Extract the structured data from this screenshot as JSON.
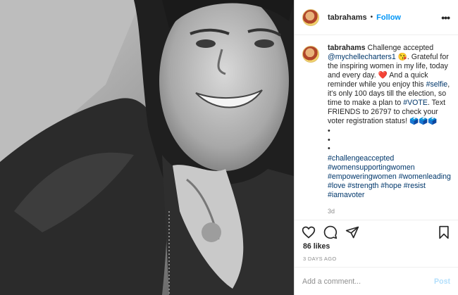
{
  "header": {
    "username": "tabrahams",
    "separator": "•",
    "follow_label": "Follow",
    "more_label": "•••"
  },
  "caption": {
    "username": "tabrahams",
    "text_1": "Challenge accepted",
    "mention": "@mychellecharters1",
    "emoji_1": "😘",
    "text_2": ". Grateful for the inspiring women in my life, today and every day.",
    "emoji_2": "❤️",
    "text_3": " And a quick reminder while you enjoy this",
    "tag_selfie": "#selfie",
    "text_4": ", it's only 100 days till the election, so time to make a plan to",
    "tag_vote": "#VOTE",
    "text_5": ". Text FRIENDS to 26797 to check your voter registration status!",
    "emoji_3": "🗳️🗳️🗳️",
    "bullets": [
      "•",
      "•",
      "•"
    ],
    "hashtags": "#challengeaccepted #womensupportingwomen #empoweringwomen #womenleading #love #strength #hope #resist #iamavoter",
    "time": "3d"
  },
  "actions": {
    "like_icon": "heart-icon",
    "comment_icon": "comment-icon",
    "share_icon": "paper-plane-icon",
    "save_icon": "bookmark-icon"
  },
  "likes": "86 likes",
  "posted_ago": "3 DAYS AGO",
  "comment_box": {
    "placeholder": "Add a comment...",
    "post_label": "Post"
  },
  "colors": {
    "link": "#0095f6",
    "tag": "#00376b",
    "muted": "#8e8e8e",
    "post_disabled": "#b2dffc"
  }
}
